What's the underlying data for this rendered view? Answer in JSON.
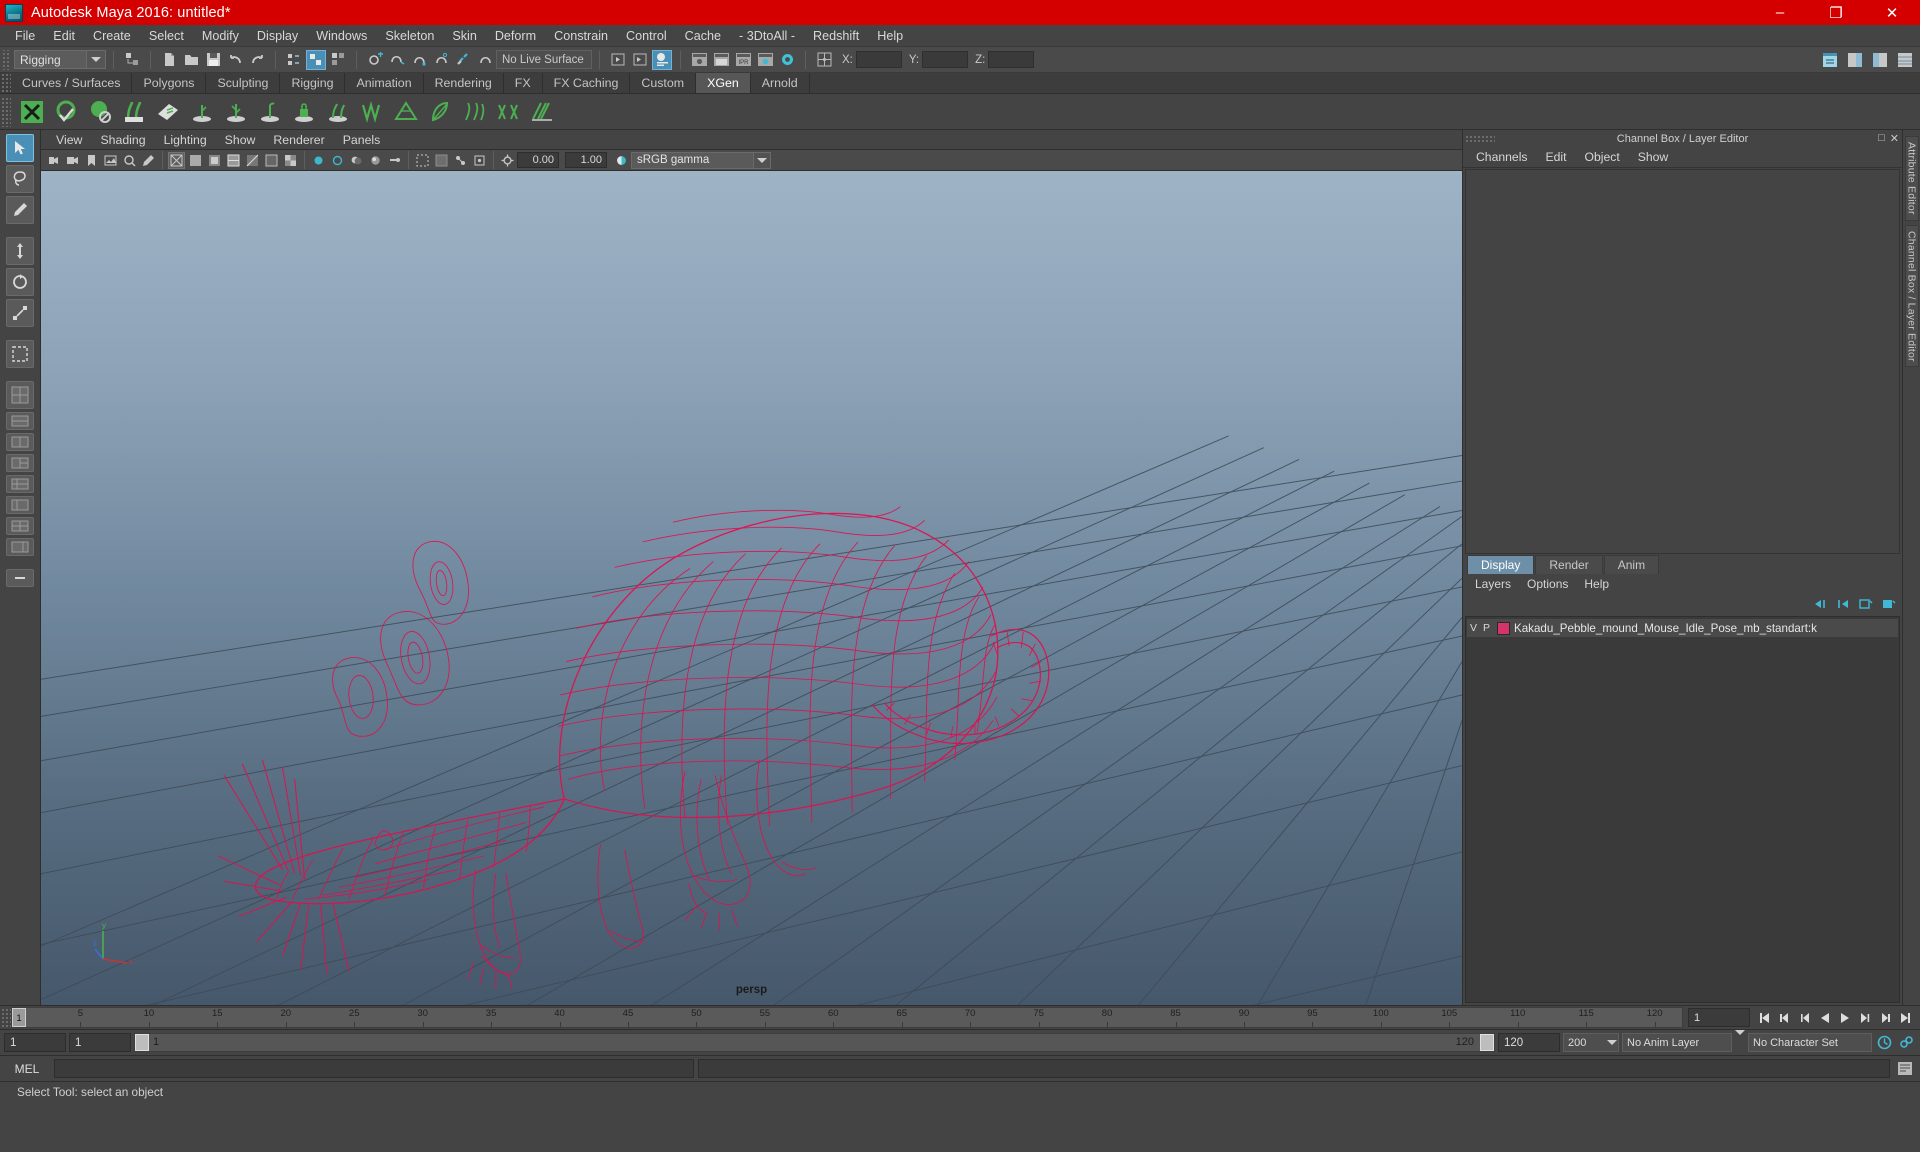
{
  "window": {
    "title": "Autodesk Maya 2016: untitled*",
    "icon": "maya-app-icon",
    "minimize": "–",
    "maximize": "❐",
    "close": "✕"
  },
  "menubar": {
    "items": [
      {
        "label": "File"
      },
      {
        "label": "Edit"
      },
      {
        "label": "Create"
      },
      {
        "label": "Select"
      },
      {
        "label": "Modify"
      },
      {
        "label": "Display"
      },
      {
        "label": "Windows"
      },
      {
        "label": "Skeleton"
      },
      {
        "label": "Skin"
      },
      {
        "label": "Deform"
      },
      {
        "label": "Constrain"
      },
      {
        "label": "Control"
      },
      {
        "label": "Cache"
      },
      {
        "label": "- 3DtoAll -"
      },
      {
        "label": "Redshift"
      },
      {
        "label": "Help"
      }
    ]
  },
  "statusbar": {
    "menuset": "Rigging",
    "live_surface": "No Live Surface",
    "coord_labels": [
      "X:",
      "Y:",
      "Z:"
    ],
    "coord_values": [
      "",
      "",
      ""
    ]
  },
  "shelf": {
    "tabs": [
      {
        "label": "Curves / Surfaces",
        "active": false
      },
      {
        "label": "Polygons",
        "active": false
      },
      {
        "label": "Sculpting",
        "active": false
      },
      {
        "label": "Rigging",
        "active": false
      },
      {
        "label": "Animation",
        "active": false
      },
      {
        "label": "Rendering",
        "active": false
      },
      {
        "label": "FX",
        "active": false
      },
      {
        "label": "FX Caching",
        "active": false
      },
      {
        "label": "Custom",
        "active": false
      },
      {
        "label": "XGen",
        "active": true
      },
      {
        "label": "Arnold",
        "active": false
      }
    ]
  },
  "panel_menu": {
    "items": [
      "View",
      "Shading",
      "Lighting",
      "Show",
      "Renderer",
      "Panels"
    ]
  },
  "view_toolbar": {
    "exposure": "0.00",
    "gamma": "1.00",
    "color_profile": "sRGB gamma"
  },
  "viewport": {
    "camera_label": "persp",
    "model": "red-wireframe-mouse",
    "wireframe_color": "#e01050",
    "grid_color": "#3b4a57",
    "bg_top": "#9cb0c4",
    "bg_bottom": "#47596c",
    "axis": {
      "x": "x",
      "y": "y",
      "z": "z"
    }
  },
  "channelbox": {
    "header": "Channel Box / Layer Editor",
    "menu": [
      "Channels",
      "Edit",
      "Object",
      "Show"
    ]
  },
  "layer_editor": {
    "tabs": [
      {
        "label": "Display",
        "active": true
      },
      {
        "label": "Render",
        "active": false
      },
      {
        "label": "Anim",
        "active": false
      }
    ],
    "menu": [
      "Layers",
      "Options",
      "Help"
    ],
    "columns": [
      "V",
      "P"
    ],
    "layers": [
      {
        "visible": "V",
        "playback": "P",
        "color": "#d4336b",
        "name": "Kakadu_Pebble_mound_Mouse_Idle_Pose_mb_standart:k"
      }
    ]
  },
  "dock_labels": {
    "attribute_editor": "Attribute Editor",
    "channel_box": "Channel Box / Layer Editor"
  },
  "timeslider": {
    "start_tick": "1",
    "current_frame": "1",
    "ticks": [
      "5",
      "10",
      "15",
      "20",
      "25",
      "30",
      "35",
      "40",
      "45",
      "50",
      "55",
      "60",
      "65",
      "70",
      "75",
      "80",
      "85",
      "90",
      "95",
      "100",
      "105",
      "110",
      "115",
      "120"
    ],
    "current_field": "1"
  },
  "rangeslider": {
    "anim_start": "1",
    "range_start": "1",
    "range_handle_left": "1",
    "range_handle_right": "120",
    "range_end": "120",
    "anim_end": "200",
    "anim_layer": "No Anim Layer",
    "character_set": "No Character Set"
  },
  "commandline": {
    "mode": "MEL",
    "input": "",
    "result": ""
  },
  "helpline": {
    "text": "Select Tool: select an object"
  }
}
